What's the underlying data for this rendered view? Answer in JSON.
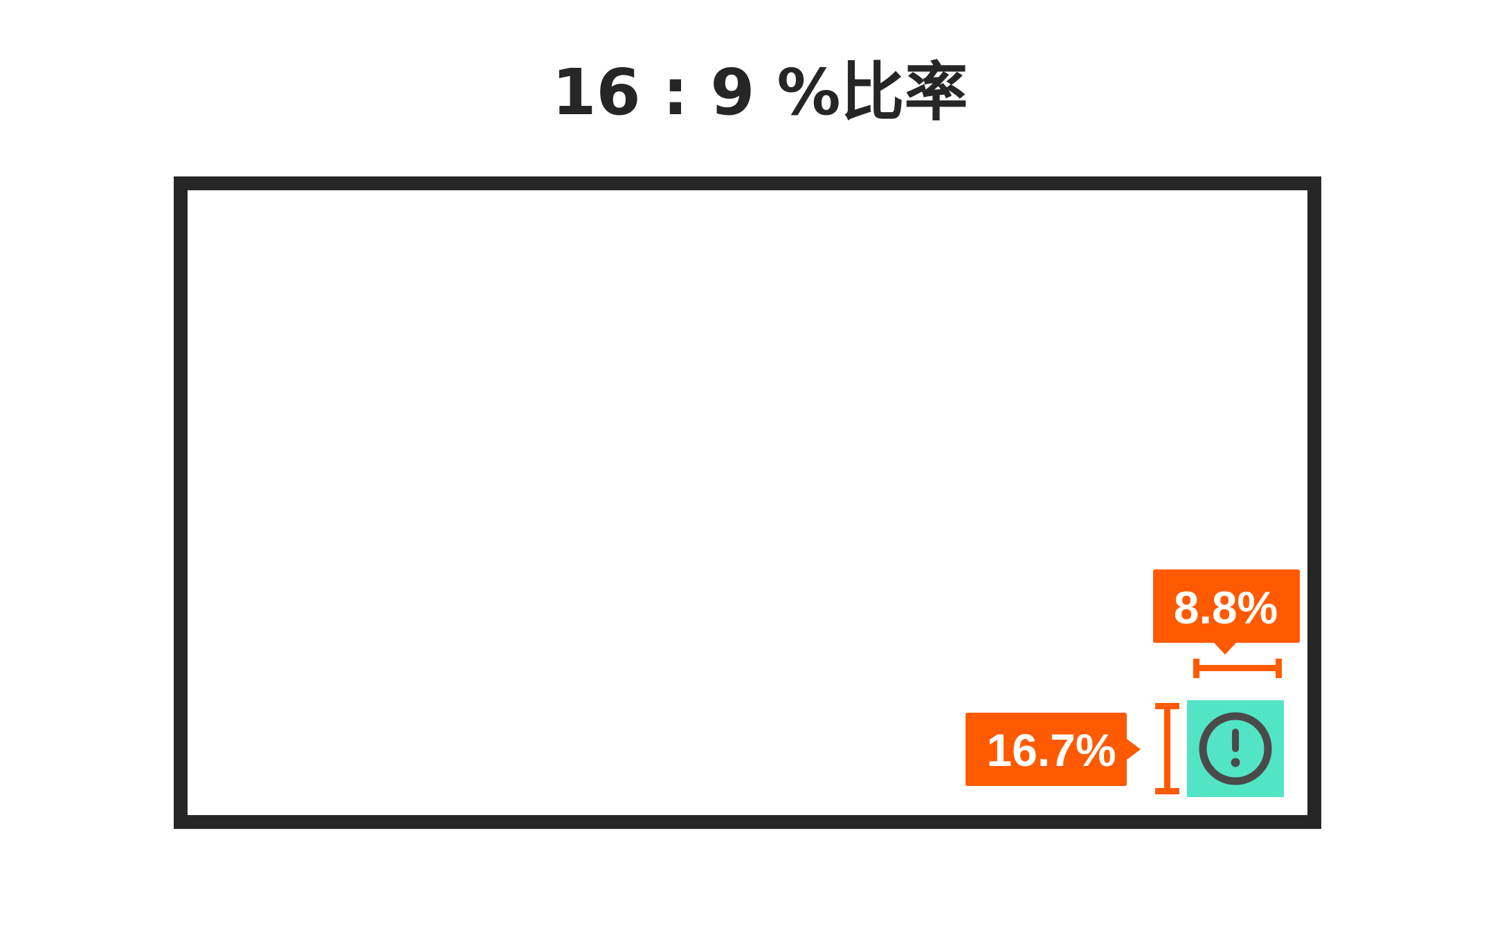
{
  "title": "16 : 9 %比率",
  "colors": {
    "frame": "#262626",
    "annotation": "#ff5a00",
    "element_fill": "#52e5c5",
    "icon": "#4a4a4a",
    "label_text": "#ffffff",
    "background": "#ffffff"
  },
  "frame": {
    "aspect_ratio": "16:9"
  },
  "element": {
    "icon": "exclamation-circle-icon",
    "width_percent": 8.8,
    "height_percent": 16.7
  },
  "callouts": {
    "width_label": "8.8%",
    "height_label": "16.7%"
  }
}
